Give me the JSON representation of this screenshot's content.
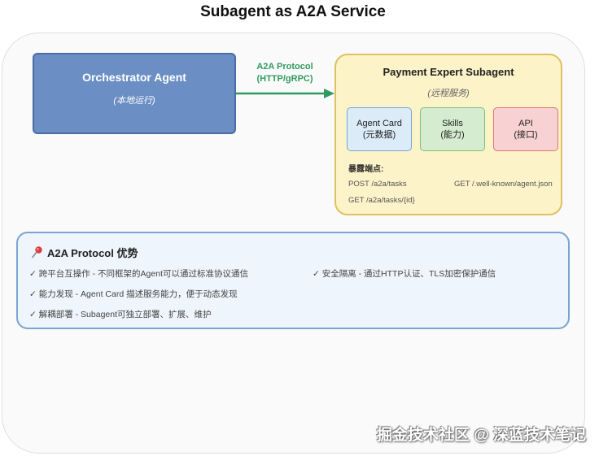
{
  "title": "Subagent as A2A Service",
  "orchestrator": {
    "name": "Orchestrator Agent",
    "subtitle": "(本地运行)"
  },
  "protocol": {
    "line1": "A2A Protocol",
    "line2": "(HTTP/gRPC)"
  },
  "payment": {
    "name": "Payment Expert Subagent",
    "subtitle": "(远程服务)",
    "components": [
      {
        "line1": "Agent Card",
        "line2": "(元数据)"
      },
      {
        "line1": "Skills",
        "line2": "(能力)"
      },
      {
        "line1": "API",
        "line2": "(接口)"
      }
    ],
    "endpoints_title": "暴露端点:",
    "endpoints": [
      "POST /a2a/tasks",
      "GET /.well-known/agent.json",
      "GET /a2a/tasks/{id}"
    ]
  },
  "benefits": {
    "title": "A2A Protocol 优势",
    "items": [
      "✓ 跨平台互操作 - 不同框架的Agent可以通过标准协议通信",
      "✓ 安全隔离 - 通过HTTP认证、TLS加密保护通信",
      "✓ 能力发现 - Agent Card 描述服务能力，便于动态发现",
      "✓ 解耦部署 - Subagent可独立部署、扩展、维护"
    ]
  },
  "watermark": "掘金技术社区 @ 深蓝技术笔记",
  "colors": {
    "orchestrator": "#6b8fc4",
    "arrow": "#2f9a5f",
    "payment_bg": "#fdf3c8",
    "card": "#dcebf8",
    "skills": "#d5ecd1",
    "api": "#f8d2d2",
    "benefits_bg": "#eef5fc"
  },
  "icons": {
    "benefits": "pushpin-icon"
  }
}
